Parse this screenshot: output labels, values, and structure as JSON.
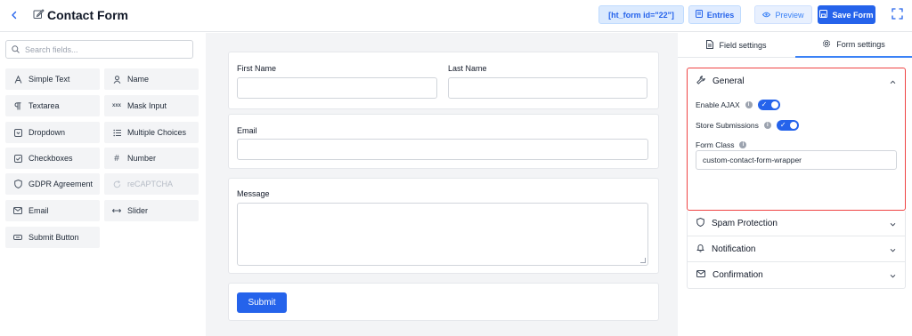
{
  "header": {
    "title": "Contact Form",
    "shortcode": "[ht_form id=\"22\"]",
    "entries_label": "Entries",
    "preview_label": "Preview",
    "save_label": "Save Form"
  },
  "sidebar": {
    "search_placeholder": "Search fields...",
    "fields": [
      {
        "label": "Simple Text",
        "icon": "text-icon"
      },
      {
        "label": "Name",
        "icon": "user-icon"
      },
      {
        "label": "Textarea",
        "icon": "paragraph-icon"
      },
      {
        "label": "Mask Input",
        "icon": "mask-icon"
      },
      {
        "label": "Dropdown",
        "icon": "dropdown-icon"
      },
      {
        "label": "Multiple Choices",
        "icon": "list-icon"
      },
      {
        "label": "Checkboxes",
        "icon": "checkbox-icon"
      },
      {
        "label": "Number",
        "icon": "hash-icon"
      },
      {
        "label": "GDPR Agreement",
        "icon": "shield-icon"
      },
      {
        "label": "reCAPTCHA",
        "icon": "refresh-icon",
        "disabled": true
      },
      {
        "label": "Email",
        "icon": "mail-icon"
      },
      {
        "label": "Slider",
        "icon": "slider-icon"
      },
      {
        "label": "Submit Button",
        "icon": "button-icon"
      }
    ]
  },
  "form": {
    "first_name_label": "First Name",
    "last_name_label": "Last Name",
    "email_label": "Email",
    "message_label": "Message",
    "submit_label": "Submit"
  },
  "settings": {
    "tabs": [
      "Field settings",
      "Form settings"
    ],
    "active_tab": "Form settings",
    "general": {
      "title": "General",
      "enable_ajax_label": "Enable AJAX",
      "enable_ajax": true,
      "store_submissions_label": "Store Submissions",
      "store_submissions": true,
      "form_class_label": "Form Class",
      "form_class_value": "custom-contact-form-wrapper"
    },
    "sections": [
      "Spam Protection",
      "Notification",
      "Confirmation"
    ]
  },
  "colors": {
    "primary": "#2563eb",
    "highlight_border": "#ef4444",
    "canvas_bg": "#f3f4f6"
  }
}
